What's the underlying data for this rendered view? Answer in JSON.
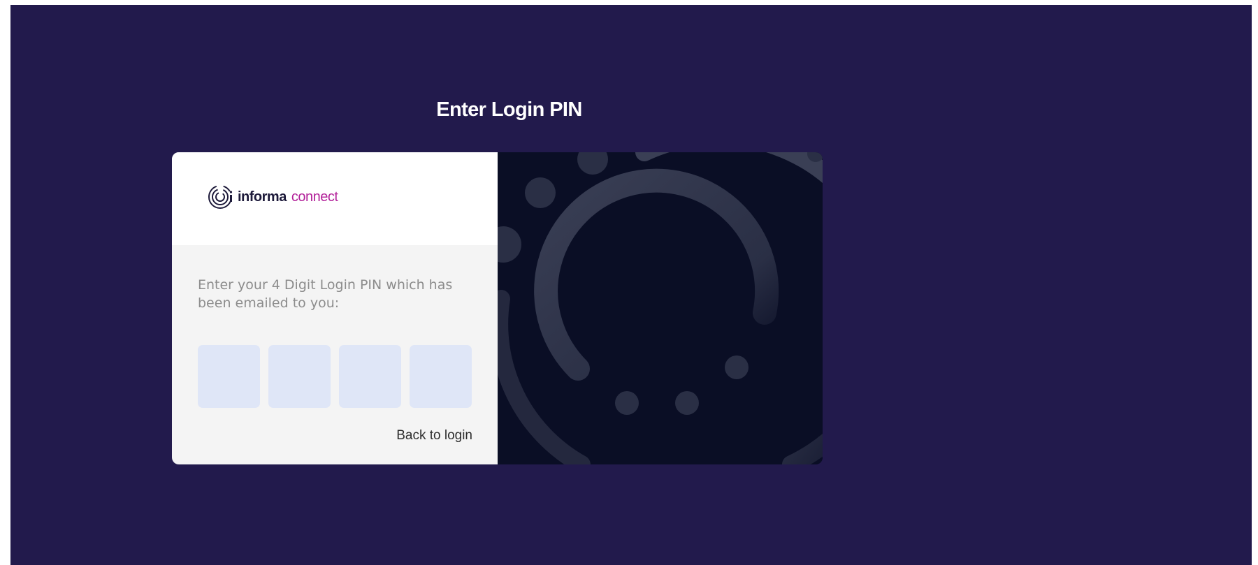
{
  "page": {
    "title": "Enter Login PIN"
  },
  "logo": {
    "word1": "informa",
    "word2": "connect"
  },
  "form": {
    "instruction": "Enter your 4 Digit Login PIN which has been emailed to you:",
    "pin_values": [
      "",
      "",
      "",
      ""
    ],
    "back_link": "Back to login"
  },
  "colors": {
    "background": "#221a4c",
    "pin_box": "#dfe6f7",
    "brand_magenta": "#b3229a",
    "art_panel": "#0a0e25"
  },
  "icons": {
    "logo_mark": "informa-circles-icon",
    "decor": "circular-arc-graphic"
  }
}
